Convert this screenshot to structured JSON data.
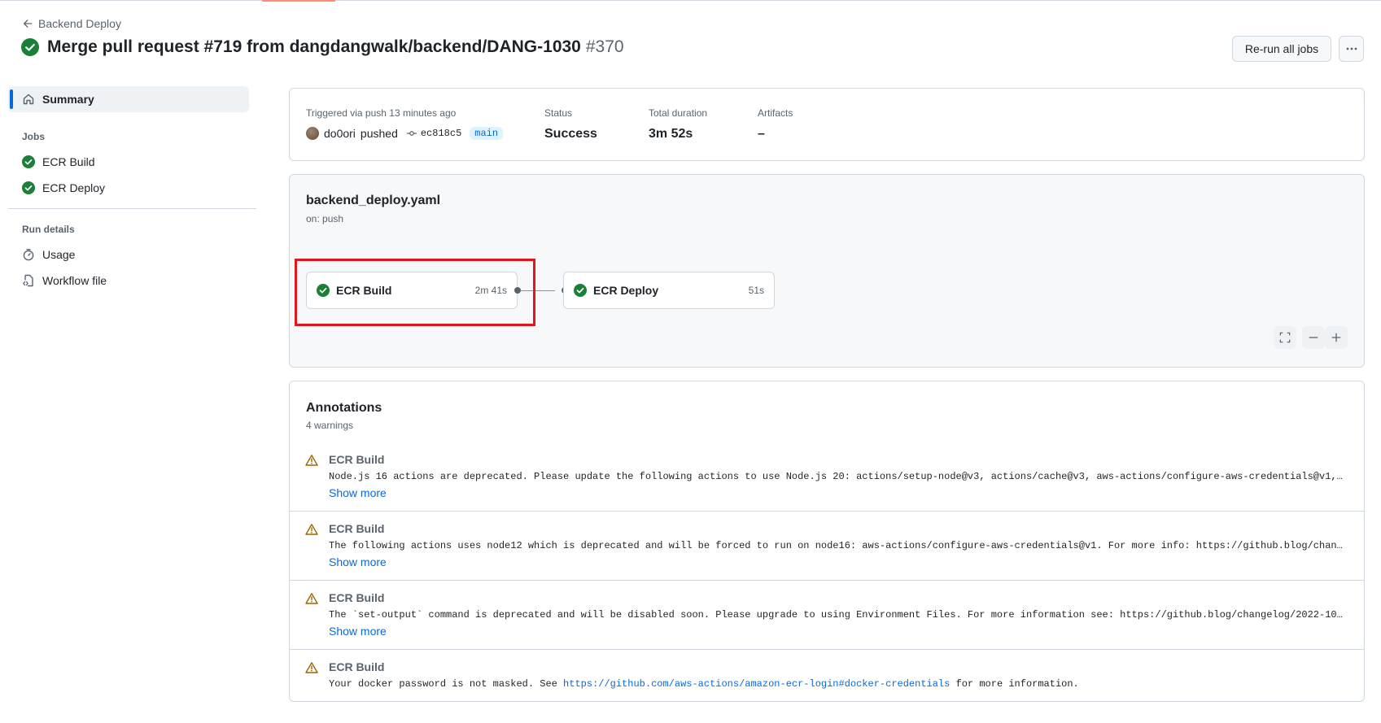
{
  "header": {
    "back_label": "Backend Deploy",
    "title": "Merge pull request #719 from dangdangwalk/backend/DANG-1030",
    "run_number": "#370",
    "rerun_label": "Re-run all jobs",
    "more_label": "⋯"
  },
  "sidebar": {
    "summary_label": "Summary",
    "jobs_heading": "Jobs",
    "jobs": [
      {
        "label": "ECR Build",
        "status": "success"
      },
      {
        "label": "ECR Deploy",
        "status": "success"
      }
    ],
    "run_details_heading": "Run details",
    "details": [
      {
        "label": "Usage",
        "icon": "stopwatch-icon"
      },
      {
        "label": "Workflow file",
        "icon": "file-code-icon"
      }
    ]
  },
  "summary": {
    "trigger_label": "Triggered via push 13 minutes ago",
    "actor": "do0ori",
    "action": "pushed",
    "commit": "ec818c5",
    "branch": "main",
    "status_label": "Status",
    "status_value": "Success",
    "duration_label": "Total duration",
    "duration_value": "3m 52s",
    "artifacts_label": "Artifacts",
    "artifacts_value": "–"
  },
  "workflow": {
    "file": "backend_deploy.yaml",
    "trigger": "on: push",
    "jobs": [
      {
        "name": "ECR Build",
        "duration": "2m 41s"
      },
      {
        "name": "ECR Deploy",
        "duration": "51s"
      }
    ]
  },
  "annotations": {
    "title": "Annotations",
    "count_label": "4 warnings",
    "show_more_label": "Show more",
    "items": [
      {
        "job": "ECR Build",
        "message": "Node.js 16 actions are deprecated. Please update the following actions to use Node.js 20: actions/setup-node@v3, actions/cache@v3, aws-actions/configure-aws-credentials@v1,…"
      },
      {
        "job": "ECR Build",
        "message": "The following actions uses node12 which is deprecated and will be forced to run on node16: aws-actions/configure-aws-credentials@v1. For more info: https://github.blog/chan…"
      },
      {
        "job": "ECR Build",
        "message": "The `set-output` command is deprecated and will be disabled soon. Please upgrade to using Environment Files. For more information see: https://github.blog/changelog/2022-10…"
      },
      {
        "job": "ECR Build",
        "message_prefix": "Your docker password is not masked. See ",
        "message_link": "https://github.com/aws-actions/amazon-ecr-login#docker-credentials",
        "message_suffix": " for more information."
      }
    ]
  },
  "colors": {
    "success": "#1a7f37",
    "link": "#0969da",
    "warning": "#9a6700",
    "highlight": "#e3161d",
    "accent_bar": "#0969da"
  }
}
